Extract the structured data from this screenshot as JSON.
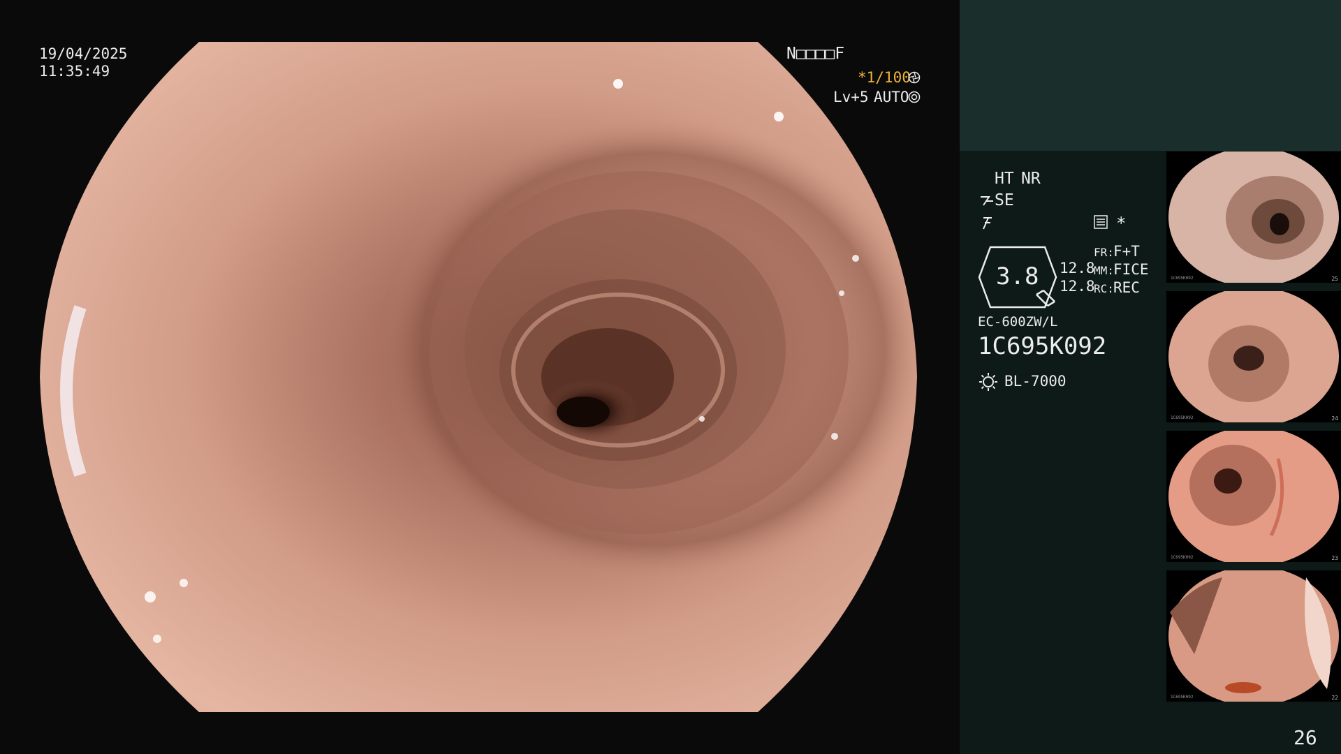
{
  "header": {
    "date": "19/04/2025",
    "time": "11:35:49"
  },
  "top_right": {
    "patient_code": "N□□□□F",
    "shutter": "*1/100",
    "shutter_icon": "aperture-icon",
    "level": "Lv+5",
    "iris_mode": "AUTO",
    "iris_icon": "iris-icon"
  },
  "panel": {
    "ht": "HT",
    "nr": "NR",
    "se": "SE",
    "zoom_value": "3.8",
    "val_1": "12.8",
    "val_2": "12.8",
    "fr_label": "FR:",
    "fr_value": "F+T",
    "mm_label": "MM:",
    "mm_value": "FICE",
    "rc_label": "RC:",
    "rc_value": "REC",
    "scope_model": "EC-600ZW/L",
    "scope_serial": "1C695K092",
    "light_source": "BL-7000",
    "image_count": "26"
  },
  "thumbnails": [
    {
      "index": "25",
      "serial": "1C695K092"
    },
    {
      "index": "24",
      "serial": "1C695K092"
    },
    {
      "index": "23",
      "serial": "1C695K092"
    },
    {
      "index": "22",
      "serial": "1C695K092"
    }
  ],
  "colors": {
    "accent_amber": "#f0b43a",
    "panel_top": "#1a2e2c",
    "panel_bg": "#0d1a18",
    "mucosa": "#c98b7a"
  }
}
